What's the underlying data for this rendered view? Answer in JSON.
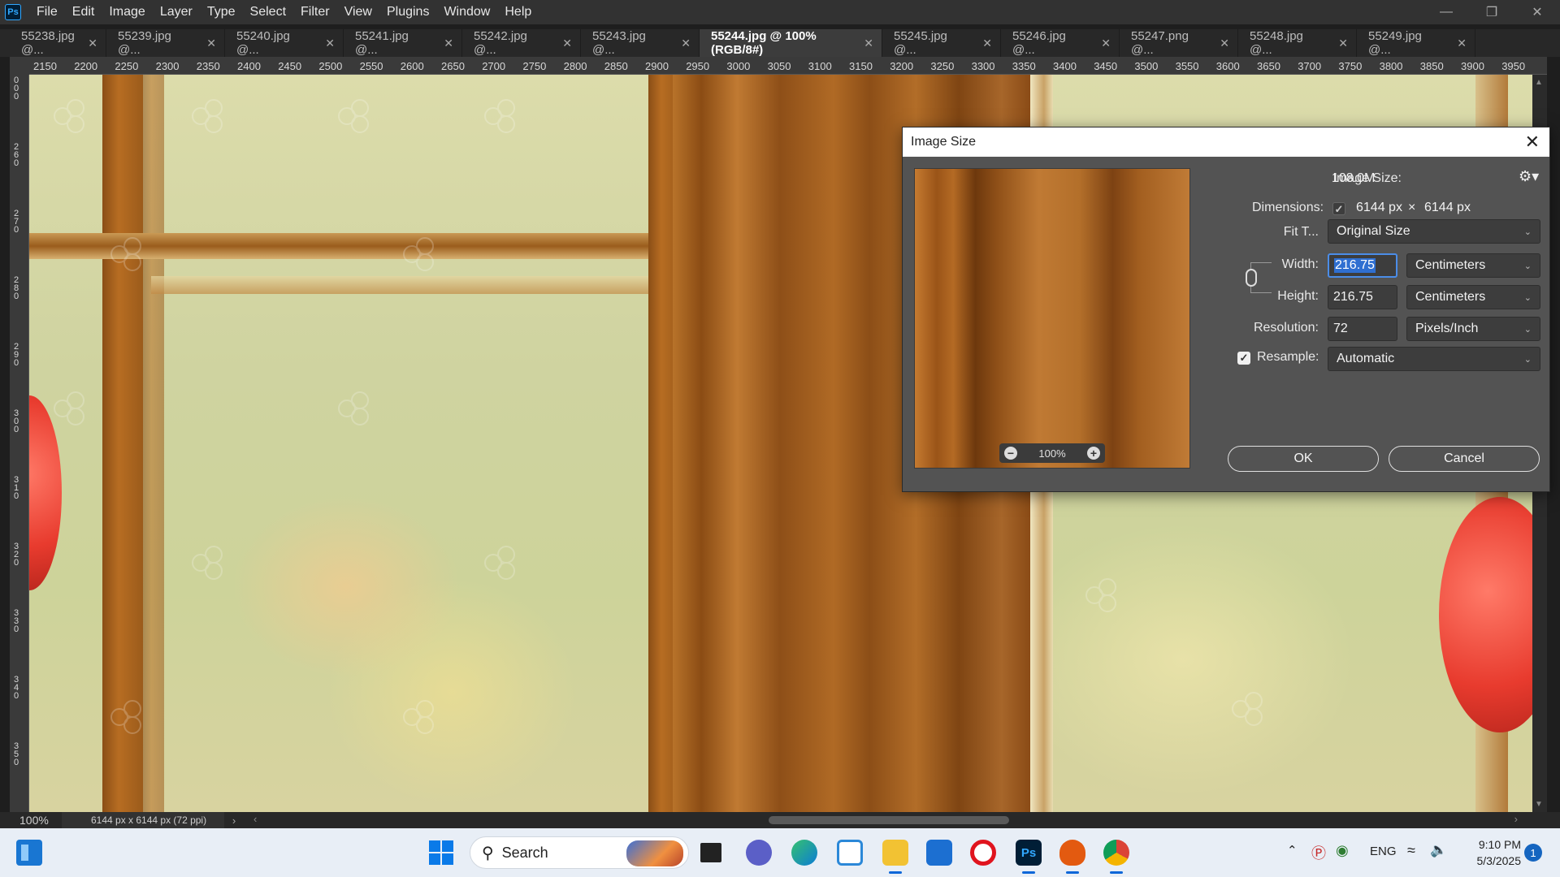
{
  "app": {
    "logo": "Ps",
    "menu": [
      "File",
      "Edit",
      "Image",
      "Layer",
      "Type",
      "Select",
      "Filter",
      "View",
      "Plugins",
      "Window",
      "Help"
    ],
    "window_controls": [
      "minimize-icon",
      "restore-icon",
      "close-icon"
    ]
  },
  "tabs": [
    {
      "label": "55238.jpg @...",
      "active": false
    },
    {
      "label": "55239.jpg @...",
      "active": false
    },
    {
      "label": "55240.jpg @...",
      "active": false
    },
    {
      "label": "55241.jpg @...",
      "active": false
    },
    {
      "label": "55242.jpg @...",
      "active": false
    },
    {
      "label": "55243.jpg @...",
      "active": false
    },
    {
      "label": "55244.jpg @ 100% (RGB/8#)",
      "active": true
    },
    {
      "label": "55245.jpg @...",
      "active": false
    },
    {
      "label": "55246.jpg @...",
      "active": false
    },
    {
      "label": "55247.png @...",
      "active": false
    },
    {
      "label": "55248.jpg @...",
      "active": false
    },
    {
      "label": "55249.jpg @...",
      "active": false
    }
  ],
  "ruler": {
    "top": [
      "2150",
      "2200",
      "2250",
      "2300",
      "2350",
      "2400",
      "2450",
      "2500",
      "2550",
      "2600",
      "2650",
      "2700",
      "2750",
      "2800",
      "2850",
      "2900",
      "2950",
      "3000",
      "3050",
      "3100",
      "3150",
      "3200",
      "3250",
      "3300",
      "3350",
      "3400",
      "3450",
      "3500",
      "3550",
      "3600",
      "3650",
      "3700",
      "3750",
      "3800",
      "3850",
      "3900",
      "3950"
    ],
    "left": [
      "0 0 0",
      "2 6 0",
      "2 7 0",
      "2 8 0",
      "2 9 0",
      "3 0 0",
      "3 1 0",
      "3 2 0",
      "3 3 0",
      "3 4 0",
      "3 5 0"
    ]
  },
  "dialog": {
    "title": "Image Size",
    "image_size_label": "Image Size:",
    "image_size_value": "108.0M",
    "dimensions_label": "Dimensions:",
    "dimensions_w": "6144 px",
    "dimensions_x": "×",
    "dimensions_h": "6144 px",
    "fit_label": "Fit T...",
    "fit_value": "Original Size",
    "width_label": "Width:",
    "width_value": "216.75",
    "width_unit": "Centimeters",
    "height_label": "Height:",
    "height_value": "216.75",
    "height_unit": "Centimeters",
    "resolution_label": "Resolution:",
    "resolution_value": "72",
    "resolution_unit": "Pixels/Inch",
    "resample_label": "Resample:",
    "resample_checked": true,
    "resample_value": "Automatic",
    "preview_zoom": "100%",
    "ok_label": "OK",
    "cancel_label": "Cancel"
  },
  "status": {
    "zoom": "100%",
    "doc_info": "6144 px x 6144 px (72 ppi)"
  },
  "taskbar": {
    "search_placeholder": "Search",
    "apps": [
      "task-view-icon",
      "chat-icon",
      "edge-icon",
      "store-gallery-icon",
      "file-explorer-icon",
      "microsoft-store-icon",
      "opera-icon",
      "photoshop-icon",
      "g-app-icon",
      "chrome-icon"
    ],
    "photoshop_label": "Ps",
    "language": "ENG",
    "time": "9:10 PM",
    "date": "5/3/2025",
    "notifications": "1"
  }
}
